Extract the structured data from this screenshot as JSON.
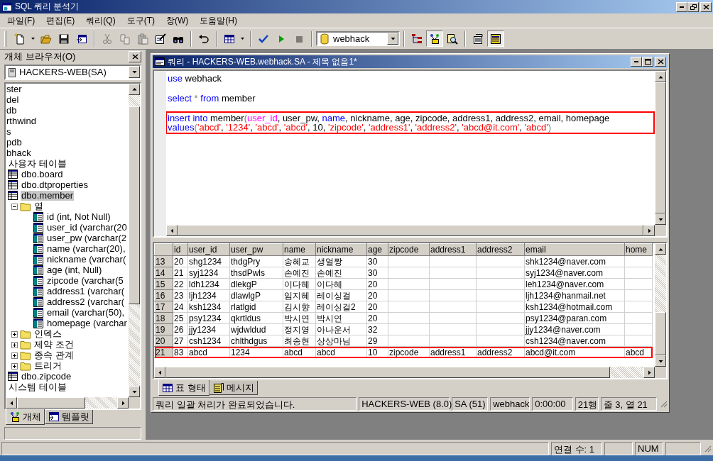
{
  "window": {
    "title": "SQL 쿼리 분석기"
  },
  "menu": [
    "파일(F)",
    "편집(E)",
    "쿼리(Q)",
    "도구(T)",
    "창(W)",
    "도움말(H)"
  ],
  "toolbar": {
    "items": [
      {
        "kind": "new",
        "disabled": false,
        "on": false
      },
      {
        "kind": "caret",
        "disabled": false,
        "on": false
      },
      {
        "kind": "open",
        "disabled": false,
        "on": false
      },
      {
        "kind": "save",
        "disabled": false,
        "on": false
      },
      {
        "kind": "import",
        "disabled": false,
        "on": false
      },
      {
        "kind": "separator"
      },
      {
        "kind": "cut",
        "disabled": true,
        "on": false
      },
      {
        "kind": "copy",
        "disabled": true,
        "on": false
      },
      {
        "kind": "paste",
        "disabled": true,
        "on": false
      },
      {
        "kind": "edit",
        "disabled": false,
        "on": false
      },
      {
        "kind": "find",
        "disabled": false,
        "on": false
      },
      {
        "kind": "separator"
      },
      {
        "kind": "undo",
        "disabled": false,
        "on": false
      },
      {
        "kind": "separator"
      },
      {
        "kind": "grid",
        "disabled": false,
        "on": false
      },
      {
        "kind": "caret",
        "disabled": false,
        "on": false
      },
      {
        "kind": "separator"
      },
      {
        "kind": "check",
        "disabled": false,
        "on": false
      },
      {
        "kind": "run",
        "disabled": false,
        "on": false
      },
      {
        "kind": "stop",
        "disabled": true,
        "on": false
      },
      {
        "kind": "separator"
      },
      {
        "kind": "database",
        "value": "webhack"
      },
      {
        "kind": "separator"
      },
      {
        "kind": "tree",
        "disabled": false,
        "on": false
      },
      {
        "kind": "browser",
        "disabled": false,
        "on": true
      },
      {
        "kind": "search",
        "disabled": false,
        "on": false
      },
      {
        "kind": "separator"
      },
      {
        "kind": "properties",
        "disabled": false,
        "on": false
      },
      {
        "kind": "table-view",
        "disabled": false,
        "on": true
      }
    ]
  },
  "left_panel": {
    "title": "개체 브라우저(O)",
    "server": "HACKERS-WEB(SA)",
    "tree": [
      {
        "label": "ster",
        "kind": "database",
        "selected": false
      },
      {
        "label": "del",
        "kind": "database",
        "selected": false
      },
      {
        "label": "db",
        "kind": "database",
        "selected": false
      },
      {
        "label": "rthwind",
        "kind": "database",
        "selected": false
      },
      {
        "label": "s",
        "kind": "database",
        "selected": false
      },
      {
        "label": "pdb",
        "kind": "database",
        "selected": false
      },
      {
        "label": "bhack",
        "kind": "database",
        "selected": false,
        "children": [
          {
            "label": "사용자 테이블",
            "selected": false,
            "children": [
              {
                "label": "dbo.board",
                "kind": "table",
                "selected": false
              },
              {
                "label": "dbo.dtproperties",
                "kind": "table",
                "selected": false
              },
              {
                "label": "dbo.member",
                "kind": "table",
                "selected": true,
                "children": [
                  {
                    "label": "열",
                    "kind": "folder",
                    "expanded": true,
                    "selected": false,
                    "children": [
                      {
                        "label": "id (int, Not Null)",
                        "kind": "column",
                        "selected": false
                      },
                      {
                        "label": "user_id (varchar(20",
                        "kind": "column",
                        "selected": false
                      },
                      {
                        "label": "user_pw (varchar(2",
                        "kind": "column",
                        "selected": false
                      },
                      {
                        "label": "name (varchar(20),",
                        "kind": "column",
                        "selected": false
                      },
                      {
                        "label": "nickname (varchar(",
                        "kind": "column",
                        "selected": false
                      },
                      {
                        "label": "age (int, Null)",
                        "kind": "column",
                        "selected": false
                      },
                      {
                        "label": "zipcode (varchar(5",
                        "kind": "column",
                        "selected": false
                      },
                      {
                        "label": "address1 (varchar(",
                        "kind": "column",
                        "selected": false
                      },
                      {
                        "label": "address2 (varchar(",
                        "kind": "column",
                        "selected": false
                      },
                      {
                        "label": "email (varchar(50),",
                        "kind": "column",
                        "selected": false
                      },
                      {
                        "label": "homepage (varchar",
                        "kind": "column",
                        "selected": false
                      }
                    ]
                  },
                  {
                    "label": "인덱스",
                    "kind": "folder",
                    "expanded": false,
                    "selected": false
                  },
                  {
                    "label": "제약 조건",
                    "kind": "folder",
                    "expanded": false,
                    "selected": false
                  },
                  {
                    "label": "종속 관계",
                    "kind": "folder",
                    "expanded": false,
                    "selected": false
                  },
                  {
                    "label": "트리거",
                    "kind": "folder",
                    "expanded": false,
                    "selected": false
                  }
                ]
              },
              {
                "label": "dbo.zipcode",
                "kind": "table",
                "selected": false
              }
            ]
          },
          {
            "label": "시스템 테이블",
            "selected": false
          }
        ]
      }
    ],
    "tabs": [
      {
        "label": "개체",
        "kind": "objects",
        "selected": true
      },
      {
        "label": "템플릿",
        "kind": "templates",
        "selected": false
      }
    ]
  },
  "query_window": {
    "title": "쿼리 - HACKERS-WEB.webhack.SA - 제목 없음1*",
    "editor": {
      "statements": [
        {
          "highlighted": false,
          "lines": [
            [
              {
                "kind": "keyword",
                "text": "use"
              },
              {
                "kind": "plain",
                "text": " webhack"
              }
            ]
          ]
        },
        {
          "highlighted": false,
          "lines": [
            [
              {
                "kind": "keyword",
                "text": "select"
              },
              {
                "kind": "operator",
                "text": " * "
              },
              {
                "kind": "keyword",
                "text": "from"
              },
              {
                "kind": "plain",
                "text": " member"
              }
            ]
          ]
        },
        {
          "highlighted": true,
          "lines": [
            [
              {
                "kind": "keyword",
                "text": "insert into"
              },
              {
                "kind": "plain",
                "text": " member"
              },
              {
                "kind": "operator",
                "text": "("
              },
              {
                "kind": "function",
                "text": "user_id"
              },
              {
                "kind": "plain",
                "text": ", user_pw, "
              },
              {
                "kind": "keyword",
                "text": "name"
              },
              {
                "kind": "plain",
                "text": ", nickname, age, zipcode, address1, address2, email, homepage"
              }
            ],
            [
              {
                "kind": "keyword",
                "text": "values"
              },
              {
                "kind": "operator",
                "text": "("
              },
              {
                "kind": "string",
                "text": "'abcd'"
              },
              {
                "kind": "plain",
                "text": ", "
              },
              {
                "kind": "string",
                "text": "'1234'"
              },
              {
                "kind": "plain",
                "text": ", "
              },
              {
                "kind": "string",
                "text": "'abcd'"
              },
              {
                "kind": "plain",
                "text": ", "
              },
              {
                "kind": "string",
                "text": "'abcd'"
              },
              {
                "kind": "plain",
                "text": ", 10, "
              },
              {
                "kind": "string",
                "text": "'zipcode'"
              },
              {
                "kind": "plain",
                "text": ", "
              },
              {
                "kind": "string",
                "text": "'address1'"
              },
              {
                "kind": "plain",
                "text": ", "
              },
              {
                "kind": "string",
                "text": "'address2'"
              },
              {
                "kind": "plain",
                "text": ", "
              },
              {
                "kind": "string",
                "text": "'abcd@it.com'"
              },
              {
                "kind": "plain",
                "text": ", "
              },
              {
                "kind": "string",
                "text": "'abcd'"
              },
              {
                "kind": "operator",
                "text": ")"
              }
            ]
          ]
        }
      ]
    },
    "results": {
      "columns": [
        "id",
        "user_id",
        "user_pw",
        "name",
        "nickname",
        "age",
        "zipcode",
        "address1",
        "address2",
        "email",
        "home"
      ],
      "rows": [
        {
          "number": "13",
          "highlighted": false,
          "cells": [
            "20",
            "shg1234",
            "thdgPry",
            "송혜교",
            "생얼짱",
            "30",
            null,
            null,
            null,
            "shk1234@naver.com",
            null
          ]
        },
        {
          "number": "14",
          "highlighted": false,
          "cells": [
            "21",
            "syj1234",
            "thsdPwls",
            "손예진",
            "손예진",
            "30",
            null,
            null,
            null,
            "syj1234@naver.com",
            null
          ]
        },
        {
          "number": "15",
          "highlighted": false,
          "cells": [
            "22",
            "ldh1234",
            "dlekgP",
            "이다혜",
            "이다혜",
            "20",
            null,
            null,
            null,
            "leh1234@naver.com",
            null
          ]
        },
        {
          "number": "16",
          "highlighted": false,
          "cells": [
            "23",
            "ljh1234",
            "dlawlgP",
            "임지혜",
            "레이싱걸",
            "20",
            null,
            null,
            null,
            "ljh1234@hanmail.net",
            null
          ]
        },
        {
          "number": "17",
          "highlighted": false,
          "cells": [
            "24",
            "ksh1234",
            "rlatlgid",
            "김시향",
            "레이싱걸2",
            "20",
            null,
            null,
            null,
            "ksh1234@hotmail.com",
            null
          ]
        },
        {
          "number": "18",
          "highlighted": false,
          "cells": [
            "25",
            "psy1234",
            "qkrtldus",
            "박시연",
            "박시연",
            "20",
            null,
            null,
            null,
            "psy1234@paran.com",
            null
          ]
        },
        {
          "number": "19",
          "highlighted": false,
          "cells": [
            "26",
            "jjy1234",
            "wjdwldud",
            "정지영",
            "아나운서",
            "32",
            null,
            null,
            null,
            "jjy1234@naver.com",
            null
          ]
        },
        {
          "number": "20",
          "highlighted": false,
          "cells": [
            "27",
            "csh1234",
            "chlthdgus",
            "최송현",
            "상상마님",
            "29",
            null,
            null,
            null,
            "csh1234@naver.com",
            null
          ]
        },
        {
          "number": "21",
          "highlighted": true,
          "cells": [
            "83",
            "abcd",
            "1234",
            "abcd",
            "abcd",
            "10",
            "zipcode",
            "address1",
            "address2",
            "abcd@it.com",
            "abcd"
          ]
        }
      ]
    },
    "tabs": [
      {
        "label": "표 형태",
        "kind": "grid",
        "selected": true
      },
      {
        "label": "메시지",
        "kind": "messages",
        "selected": false
      }
    ],
    "status_bar": [
      "쿼리 일괄 처리가 완료되었습니다.",
      "HACKERS-WEB (8.0)",
      "SA (51)",
      "webhack",
      "0:00:00",
      "21행",
      "줄 3, 열 21"
    ]
  },
  "status_bar": [
    "연결 수: 1",
    "NUM"
  ]
}
